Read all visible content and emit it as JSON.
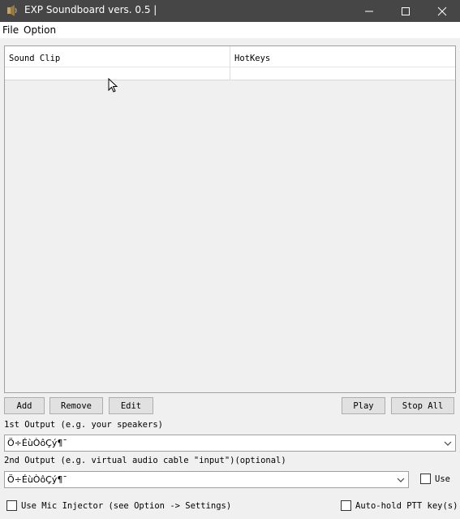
{
  "window": {
    "title": "EXP Soundboard vers. 0.5 |",
    "icon": "speaker-app-icon",
    "controls": [
      "minimize-icon",
      "maximize-icon",
      "close-icon"
    ]
  },
  "menu": {
    "file": "File",
    "option": "Option"
  },
  "sound_list": {
    "columns": [
      "Sound Clip",
      "HotKeys"
    ],
    "rows": []
  },
  "buttons": {
    "add": "Add",
    "remove": "Remove",
    "edit": "Edit",
    "play": "Play",
    "stop_all": "Stop All"
  },
  "output1": {
    "label": "1st Output (e.g. your speakers)",
    "value": "Ö÷ÉùÒôÇý¶¯"
  },
  "output2": {
    "label": "2nd Output (e.g. virtual audio cable \"input\")(optional)",
    "value": "Ö÷ÉùÒôÇý¶¯",
    "use_label": "Use"
  },
  "footer": {
    "mic_injector": "Use Mic Injector (see Option -> Settings)",
    "auto_hold": "Auto-hold PTT key(s)"
  },
  "colors": {
    "titlebar": "#464646",
    "menubar": "#ffffff",
    "window_bg": "#f0f0f0"
  }
}
